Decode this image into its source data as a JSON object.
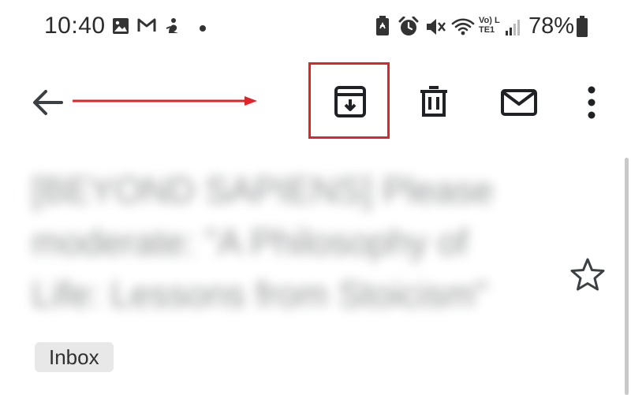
{
  "status_bar": {
    "time": "10:40",
    "battery_percent": "78%",
    "network_label": "Vo) LTE1",
    "notification_icons": [
      "image-icon",
      "gmail-icon",
      "app-icon",
      "dot-icon"
    ],
    "system_icons": [
      "battery-saver-icon",
      "alarm-icon",
      "mute-icon",
      "wifi-icon",
      "signal-icon",
      "battery-icon"
    ]
  },
  "toolbar": {
    "back_icon": "back-arrow-icon",
    "archive_icon": "archive-icon",
    "delete_icon": "trash-icon",
    "mark_unread_icon": "mail-icon",
    "more_icon": "more-vert-icon"
  },
  "annotation": {
    "highlight_color": "#e0252a",
    "target": "archive-button"
  },
  "message": {
    "subject_lines": [
      "[BEYOND SAPIENS] Please",
      "moderate: \"A Philosophy of",
      "Life: Lessons from Stoicism\""
    ],
    "subject_blurred": true,
    "label": "Inbox",
    "starred": false
  }
}
